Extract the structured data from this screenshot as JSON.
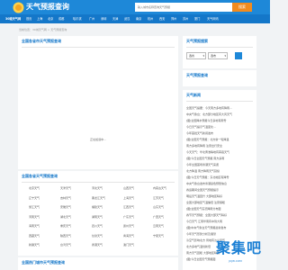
{
  "header": {
    "site_name": "天气预报查询",
    "search_placeholder": "输入城市名称查询天气预报",
    "search_button": "搜索"
  },
  "nav": {
    "items": [
      "30城天气网",
      "首页",
      "上海",
      "北京",
      "成都",
      "哈尔滨",
      "广州",
      "深圳",
      "天津",
      "武汉",
      "南京",
      "杭州",
      "西安",
      "郑州",
      "苏州",
      "厦门",
      "天气网讯"
    ]
  },
  "breadcrumb": "当前位置：30城天气网 > 天气预报查询",
  "main": {
    "title": "全国各省市天气预报查询",
    "loading_text": "正在加载中..."
  },
  "weather_search": {
    "title": "天气预报搜索",
    "province": "选省",
    "city": "选市"
  },
  "weather_forecast": {
    "title": "天气预报查询"
  },
  "weather_news": {
    "title": "天气新闻",
    "items": [
      "全国天气提要：今天南方多地有降雨...",
      "中央气象台：北方部分地区有大风天气",
      "[图]全国降水预报今日多地有雨雪",
      "今日天气提示气温变化...",
      "今年首批天气新闻发布",
      "[图]全国天气预报：北方新一轮降温",
      "南方多地有降雨 注意出行安全",
      "今天天气：华北黄淮等地有雾霾天气",
      "[图]今日全国天气预报 南方多雨",
      "今年全国首场寒潮天气来袭",
      "北方降温 南方降雨天气延续",
      "[图]今日天气预报：东北地区有降雪",
      "中央气象台发布寒潮蓝色预警信息",
      "春运期间全国天气预报提示",
      "明后天气温回升 大部地区晴好",
      "全国大部地区气温偏低 注意保暖",
      "[图]全国天气实况降雨分布图",
      "春节天气预报：全国大部天气晴好",
      "今日天气 江南华南有中到大雨",
      "[图]中央气象台天气预报最新发布",
      "今年天气形势分析及展望",
      "冷空气影响北方 局地有沙尘天气",
      "北方多地气温创新低",
      "南方天气回暖 大部地区晴朗",
      "[图]今日全国天气预报图"
    ]
  },
  "provinces": {
    "title": "全国各省天气预报查询",
    "items": [
      "北京天气",
      "天津天气",
      "河北天气",
      "山西天气",
      "内蒙古天气",
      "辽宁天气",
      "吉林天气",
      "黑龙江天气",
      "上海天气",
      "江苏天气",
      "浙江天气",
      "安徽天气",
      "福建天气",
      "江西天气",
      "山东天气",
      "河南天气",
      "湖北天气",
      "湖南天气",
      "广东天气",
      "广西天气",
      "海南天气",
      "重庆天气",
      "四川天气",
      "贵州天气",
      "云南天气",
      "西藏天气",
      "陕西天气",
      "甘肃天气",
      "青海天气",
      "宁夏天气",
      "新疆天气",
      "台湾天气",
      "香港天气",
      "澳门天气",
      ""
    ]
  },
  "hot_cities": {
    "title": "全国热门城市天气预报查询"
  },
  "watermark": {
    "main": "聚集吧",
    "sub": "JUJI8.COM"
  },
  "colors": {
    "header": "#1e88d8",
    "nav": "#1477c9",
    "accent": "#1477c9",
    "search_button": "#f28b1e"
  }
}
